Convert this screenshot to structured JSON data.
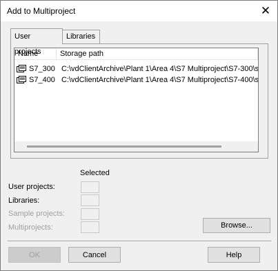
{
  "window": {
    "title": "Add to Multiproject"
  },
  "tabs": [
    {
      "label": "User projects"
    },
    {
      "label": "Libraries"
    }
  ],
  "list": {
    "columns": [
      "Name",
      "Storage path"
    ],
    "rows": [
      {
        "name": "S7_300",
        "path": "C:\\vdClientArchive\\Plant 1\\Area 4\\S7 Multiproject\\S7-300\\s"
      },
      {
        "name": "S7_400",
        "path": "C:\\vdClientArchive\\Plant 1\\Area 4\\S7 Multiproject\\S7-400\\s"
      }
    ]
  },
  "selected": {
    "header": "Selected",
    "items": [
      {
        "label": "User projects:",
        "value": ""
      },
      {
        "label": "Libraries:",
        "value": ""
      },
      {
        "label": "Sample projects:",
        "value": ""
      },
      {
        "label": "Multiprojects:",
        "value": ""
      }
    ]
  },
  "buttons": {
    "browse": "Browse...",
    "ok": "OK",
    "cancel": "Cancel",
    "help": "Help"
  },
  "icons": {
    "close": "close-icon",
    "project": "project-icon"
  }
}
